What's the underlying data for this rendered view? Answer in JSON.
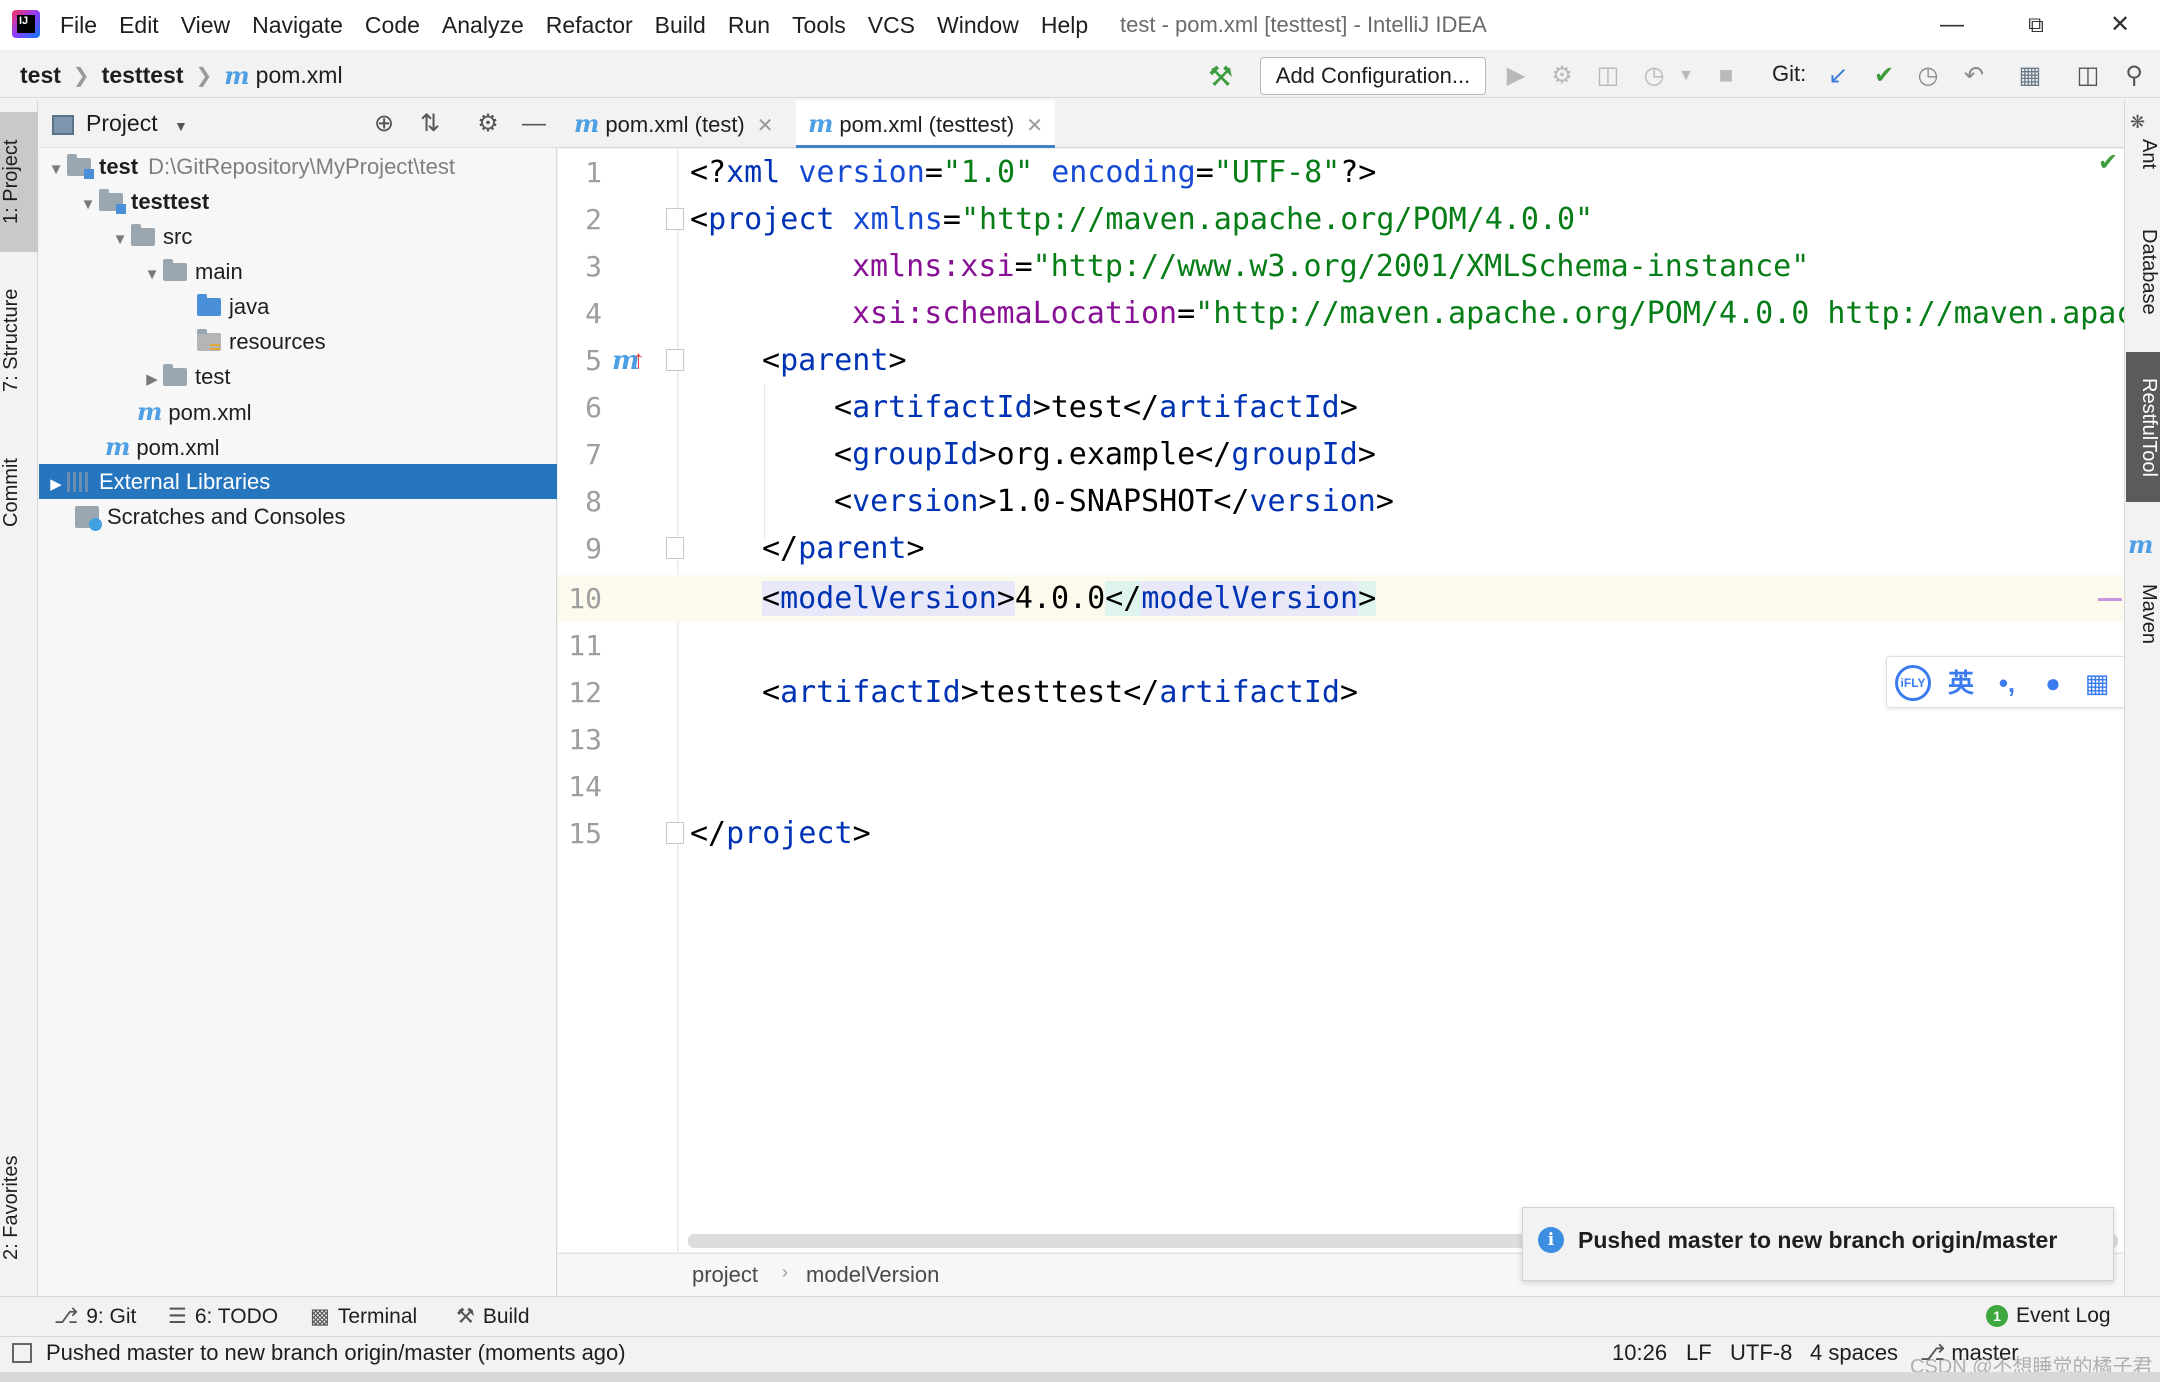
{
  "app": {
    "window_title": "test - pom.xml [testtest] - IntelliJ IDEA",
    "menu": [
      "File",
      "Edit",
      "View",
      "Navigate",
      "Code",
      "Analyze",
      "Refactor",
      "Build",
      "Run",
      "Tools",
      "VCS",
      "Window",
      "Help"
    ]
  },
  "navbar": {
    "crumbs": [
      "test",
      "testtest",
      "pom.xml"
    ],
    "add_configuration": "Add Configuration...",
    "git_label": "Git:"
  },
  "left_stripe": {
    "project": "1: Project",
    "structure": "7: Structure",
    "commit": "Commit",
    "favorites": "2: Favorites"
  },
  "project_panel": {
    "title": "Project",
    "tree": [
      {
        "label": "test",
        "path": "D:\\GitRepository\\MyProject\\test"
      },
      {
        "label": "testtest"
      },
      {
        "label": "src"
      },
      {
        "label": "main"
      },
      {
        "label": "java"
      },
      {
        "label": "resources"
      },
      {
        "label": "test"
      },
      {
        "label": "pom.xml"
      },
      {
        "label": "pom.xml"
      },
      {
        "label": "External Libraries"
      },
      {
        "label": "Scratches and Consoles"
      }
    ]
  },
  "editor_tabs": [
    {
      "label": "pom.xml (test)"
    },
    {
      "label": "pom.xml (testtest)"
    }
  ],
  "editor": {
    "line_numbers": [
      "1",
      "2",
      "3",
      "4",
      "5",
      "6",
      "7",
      "8",
      "9",
      "10",
      "11",
      "12",
      "13",
      "14",
      "15"
    ],
    "lines": {
      "l1": {
        "open": "<?",
        "name": "xml",
        "a1": " version",
        "v1": "\"1.0\"",
        "a2": " encoding",
        "v2": "\"UTF-8\"",
        "close": "?>"
      },
      "l2": {
        "open": "<",
        "name": "project",
        "attr": " xmlns",
        "val": "\"http://maven.apache.org/POM/4.0.0\""
      },
      "l3": {
        "ns": "xmlns:xsi",
        "val": "\"http://www.w3.org/2001/XMLSchema-instance\""
      },
      "l4": {
        "ns": "xsi:schemaLocation",
        "val": "\"http://maven.apache.org/POM/4.0.0 http://maven.apac"
      },
      "l5": {
        "name": "parent"
      },
      "l6": {
        "name": "artifactId",
        "text": "test"
      },
      "l7": {
        "name": "groupId",
        "text": "org.example"
      },
      "l8": {
        "name": "version",
        "text": "1.0-SNAPSHOT"
      },
      "l9": {
        "name": "parent"
      },
      "l10": {
        "name": "modelVersion",
        "text": "4.0.0"
      },
      "l12": {
        "name": "artifactId",
        "text": "testtest"
      },
      "l15": {
        "name": "project"
      }
    }
  },
  "ime_bar": {
    "brand": "iFLY",
    "lang": "英"
  },
  "editor_breadcrumbs": [
    "project",
    "modelVersion"
  ],
  "notification": {
    "text": "Pushed master to new branch origin/master"
  },
  "right_stripe": {
    "ant": "Ant",
    "database": "Database",
    "restful": "RestfulTool",
    "maven": "Maven"
  },
  "bottom_tabs": {
    "git": "9: Git",
    "todo": "6: TODO",
    "terminal": "Terminal",
    "build": "Build",
    "event_log": "Event Log",
    "event_count": "1"
  },
  "status_bar": {
    "message": "Pushed master to new branch origin/master (moments ago)",
    "position": "10:26",
    "line_sep": "LF",
    "encoding": "UTF-8",
    "indent": "4 spaces",
    "branch": "master",
    "watermark": "CSDN @不想睡觉的橘子君"
  },
  "colors": {
    "selection": "#2675bf",
    "tag": "#0033b3",
    "string": "#067d17",
    "namespace": "#871094",
    "current_line": "#fcfaed"
  }
}
